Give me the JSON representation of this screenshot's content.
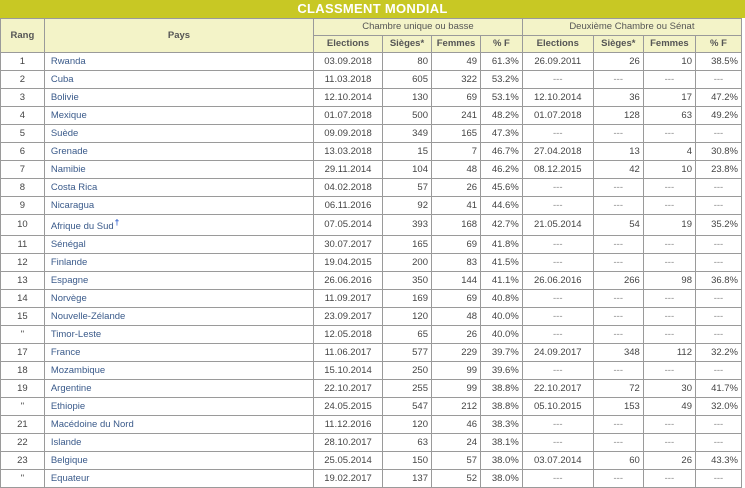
{
  "title": "CLASSMENT MONDIAL",
  "headers": {
    "rank": "Rang",
    "country": "Pays",
    "lower_group": "Chambre unique ou basse",
    "upper_group": "Deuxième Chambre ou Sénat",
    "sub": [
      "Elections",
      "Sièges*",
      "Femmes",
      "% F",
      "Elections",
      "Sièges*",
      "Femmes",
      "% F"
    ]
  },
  "rows": [
    [
      "1",
      "Rwanda",
      "03.09.2018",
      "80",
      "49",
      "61.3%",
      "26.09.2011",
      "26",
      "10",
      "38.5%"
    ],
    [
      "2",
      "Cuba",
      "11.03.2018",
      "605",
      "322",
      "53.2%",
      "---",
      "---",
      "---",
      "---"
    ],
    [
      "3",
      "Bolivie",
      "12.10.2014",
      "130",
      "69",
      "53.1%",
      "12.10.2014",
      "36",
      "17",
      "47.2%"
    ],
    [
      "4",
      "Mexique",
      "01.07.2018",
      "500",
      "241",
      "48.2%",
      "01.07.2018",
      "128",
      "63",
      "49.2%"
    ],
    [
      "5",
      "Suède",
      "09.09.2018",
      "349",
      "165",
      "47.3%",
      "---",
      "---",
      "---",
      "---"
    ],
    [
      "6",
      "Grenade",
      "13.03.2018",
      "15",
      "7",
      "46.7%",
      "27.04.2018",
      "13",
      "4",
      "30.8%"
    ],
    [
      "7",
      "Namibie",
      "29.11.2014",
      "104",
      "48",
      "46.2%",
      "08.12.2015",
      "42",
      "10",
      "23.8%"
    ],
    [
      "8",
      "Costa Rica",
      "04.02.2018",
      "57",
      "26",
      "45.6%",
      "---",
      "---",
      "---",
      "---"
    ],
    [
      "9",
      "Nicaragua",
      "06.11.2016",
      "92",
      "41",
      "44.6%",
      "---",
      "---",
      "---",
      "---"
    ],
    [
      "10",
      "Afrique du Sud",
      "07.05.2014",
      "393",
      "168",
      "42.7%",
      "21.05.2014",
      "54",
      "19",
      "35.2%"
    ],
    [
      "11",
      "Sénégal",
      "30.07.2017",
      "165",
      "69",
      "41.8%",
      "---",
      "---",
      "---",
      "---"
    ],
    [
      "12",
      "Finlande",
      "19.04.2015",
      "200",
      "83",
      "41.5%",
      "---",
      "---",
      "---",
      "---"
    ],
    [
      "13",
      "Espagne",
      "26.06.2016",
      "350",
      "144",
      "41.1%",
      "26.06.2016",
      "266",
      "98",
      "36.8%"
    ],
    [
      "14",
      "Norvège",
      "11.09.2017",
      "169",
      "69",
      "40.8%",
      "---",
      "---",
      "---",
      "---"
    ],
    [
      "15",
      "Nouvelle-Zélande",
      "23.09.2017",
      "120",
      "48",
      "40.0%",
      "---",
      "---",
      "---",
      "---"
    ],
    [
      "\"",
      "Timor-Leste",
      "12.05.2018",
      "65",
      "26",
      "40.0%",
      "---",
      "---",
      "---",
      "---"
    ],
    [
      "17",
      "France",
      "11.06.2017",
      "577",
      "229",
      "39.7%",
      "24.09.2017",
      "348",
      "112",
      "32.2%"
    ],
    [
      "18",
      "Mozambique",
      "15.10.2014",
      "250",
      "99",
      "39.6%",
      "---",
      "---",
      "---",
      "---"
    ],
    [
      "19",
      "Argentine",
      "22.10.2017",
      "255",
      "99",
      "38.8%",
      "22.10.2017",
      "72",
      "30",
      "41.7%"
    ],
    [
      "\"",
      "Ethiopie",
      "24.05.2015",
      "547",
      "212",
      "38.8%",
      "05.10.2015",
      "153",
      "49",
      "32.0%"
    ],
    [
      "21",
      "Macédoine du Nord",
      "11.12.2016",
      "120",
      "46",
      "38.3%",
      "---",
      "---",
      "---",
      "---"
    ],
    [
      "22",
      "Islande",
      "28.10.2017",
      "63",
      "24",
      "38.1%",
      "---",
      "---",
      "---",
      "---"
    ],
    [
      "23",
      "Belgique",
      "25.05.2014",
      "150",
      "57",
      "38.0%",
      "03.07.2014",
      "60",
      "26",
      "43.3%"
    ],
    [
      "\"",
      "Equateur",
      "19.02.2017",
      "137",
      "52",
      "38.0%",
      "---",
      "---",
      "---",
      "---"
    ]
  ],
  "footnote_marker_row": 9
}
